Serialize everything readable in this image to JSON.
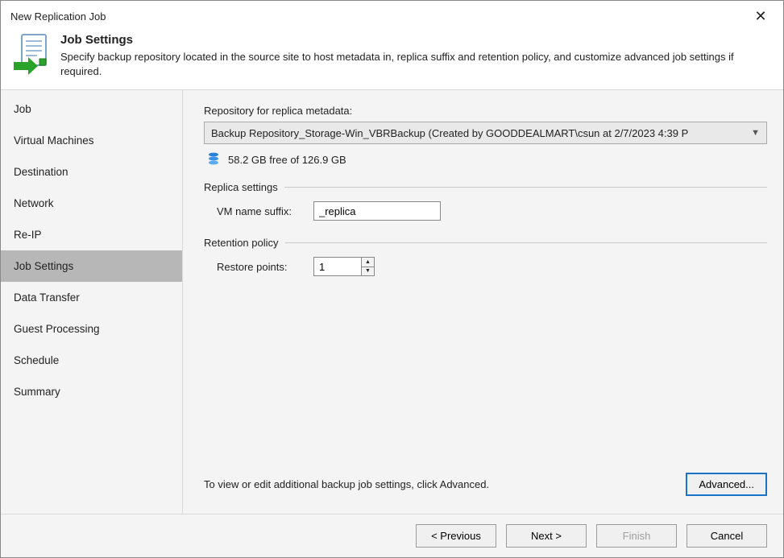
{
  "window": {
    "title": "New Replication Job"
  },
  "header": {
    "title": "Job Settings",
    "description": "Specify backup repository located in the source site to host metadata in, replica suffix and retention policy, and customize advanced job settings if required."
  },
  "sidebar": {
    "items": [
      {
        "label": "Job"
      },
      {
        "label": "Virtual Machines"
      },
      {
        "label": "Destination"
      },
      {
        "label": "Network"
      },
      {
        "label": "Re-IP"
      },
      {
        "label": "Job Settings",
        "active": true
      },
      {
        "label": "Data Transfer"
      },
      {
        "label": "Guest Processing"
      },
      {
        "label": "Schedule"
      },
      {
        "label": "Summary"
      }
    ]
  },
  "main": {
    "repository_label": "Repository for replica metadata:",
    "repository_selected": "Backup Repository_Storage-Win_VBRBackup (Created by GOODDEALMART\\csun at 2/7/2023 4:39 P",
    "storage_text": "58.2 GB free of 126.9 GB",
    "replica_settings_title": "Replica settings",
    "vm_suffix_label": "VM name suffix:",
    "vm_suffix_value": "_replica",
    "retention_title": "Retention policy",
    "restore_points_label": "Restore points:",
    "restore_points_value": "1",
    "hint": "To view or edit additional backup job settings, click Advanced.",
    "advanced_button": "Advanced..."
  },
  "footer": {
    "previous": "< Previous",
    "next": "Next >",
    "finish": "Finish",
    "cancel": "Cancel"
  }
}
